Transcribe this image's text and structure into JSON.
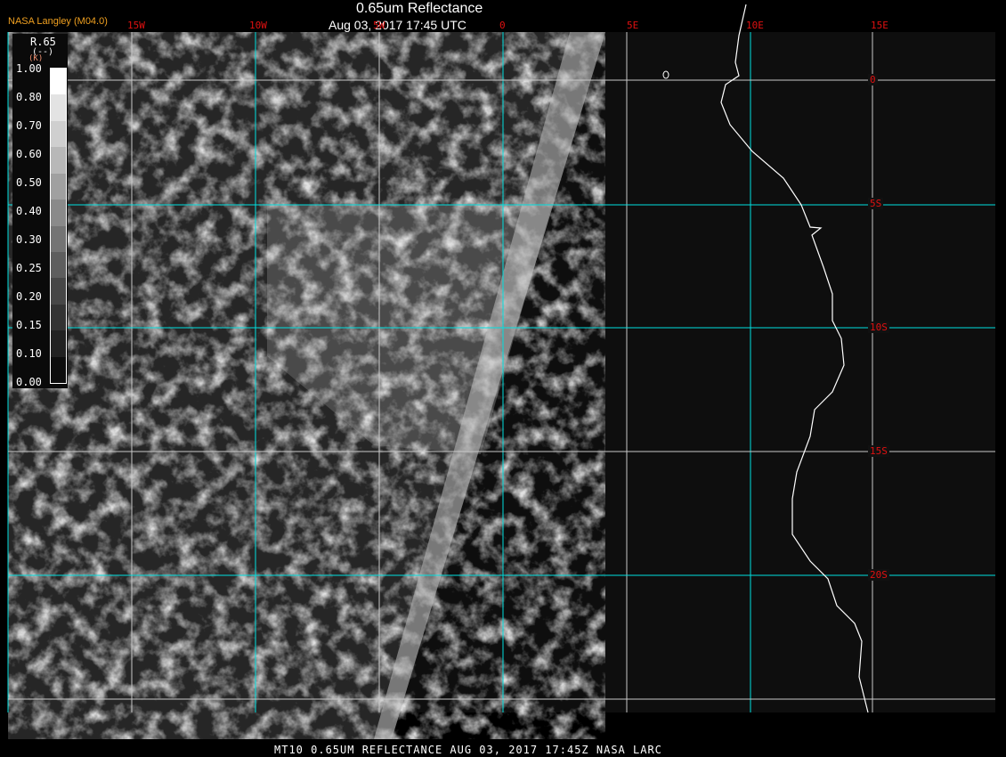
{
  "header": {
    "title": "0.65um Reflectance",
    "subtitle": "Aug 03, 2017 17:45 UTC",
    "brand": "NASA Langley (M04.0)"
  },
  "longitude_labels": [
    "15W",
    "10W",
    "5W",
    "0",
    "5E",
    "10E",
    "15E"
  ],
  "latitude_labels": [
    "0",
    "5S",
    "10S",
    "15S",
    "20S"
  ],
  "legend": {
    "title": "R.65",
    "units": "(--)",
    "units2": "(K)",
    "ticks": [
      "1.00",
      "0.80",
      "0.70",
      "0.60",
      "0.50",
      "0.40",
      "0.30",
      "0.25",
      "0.20",
      "0.15",
      "0.10",
      "0.00"
    ],
    "colors": [
      "#ffffff",
      "#e3e3e3",
      "#cfcfcf",
      "#b8b8b8",
      "#a0a0a0",
      "#8a8a8a",
      "#747474",
      "#5e5e5e",
      "#474747",
      "#333333",
      "#222222",
      "#0d0d0d"
    ]
  },
  "footer": "MT10  0.65UM REFLECTANCE   AUG 03, 2017 17:45Z   NASA LARC",
  "colors": {
    "grid_cyan": "#00e0e0",
    "grid_white": "#c8c8c8",
    "label_red": "#e01010"
  }
}
